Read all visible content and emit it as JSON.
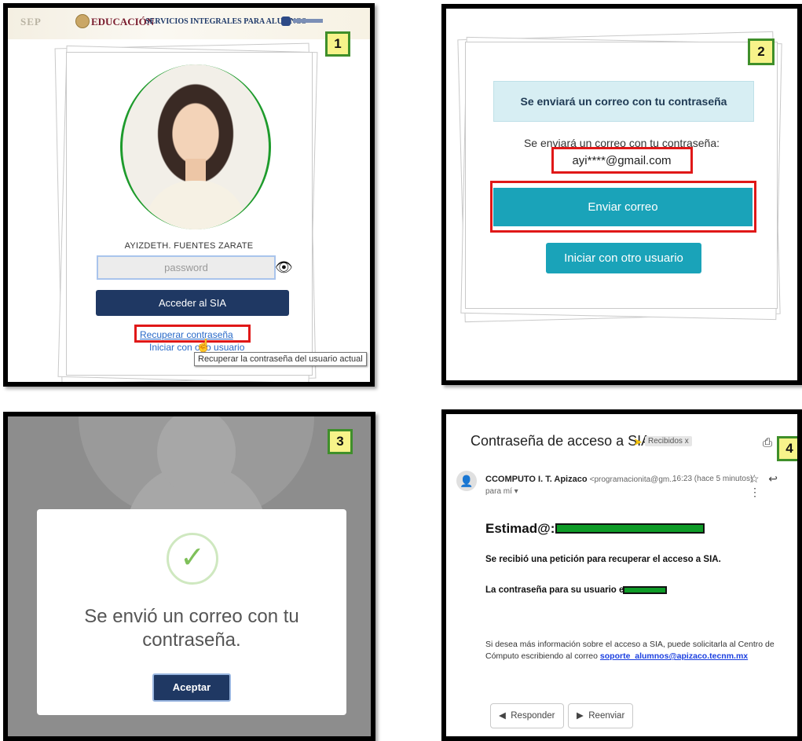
{
  "panel1": {
    "badge": "1",
    "header": {
      "logo_left": "SEP",
      "education": "EDUCACIÓN",
      "services": "SERVICIOS INTEGRALES PARA ALUMNOS"
    },
    "user_name": "AYIZDETH. FUENTES ZARATE",
    "password_placeholder": "password",
    "login_button": "Acceder al SIA",
    "recover_link": "Recuperar contraseña",
    "other_user_link": "Iniciar con otro usuario",
    "tooltip": "Recuperar la contraseña del usuario actual",
    "icons": {
      "eye": "eye-icon",
      "cursor": "hand-cursor-icon"
    }
  },
  "panel2": {
    "badge": "2",
    "info_title": "Se enviará un correo con tu contraseña",
    "info_text": "Se enviará un correo con tu contraseña:",
    "email": "ayi****@gmail.com",
    "send_button": "Enviar correo",
    "other_user_button": "Iniciar con otro usuario"
  },
  "panel3": {
    "badge": "3",
    "modal_title": "Se envió un correo con tu contraseña.",
    "accept_button": "Aceptar",
    "icons": {
      "check": "check-icon"
    }
  },
  "panel4": {
    "badge": "4",
    "subject": "Contraseña de acceso a SIA",
    "label": "Recibidos x",
    "sender_name": "CCOMPUTO I. T. Apizaco",
    "sender_address": "<programacionita@gm...",
    "time": "16:23 (hace 5 minutos)",
    "to": "para mí ▾",
    "greeting": "Estimad@:",
    "line1": "Se recibió una petición para recuperar el acceso a SIA.",
    "line2": "La contraseña para su usuario es:",
    "info_text": "Si desea más información sobre el acceso a SIA, puede solicitarla al Centro de Cómputo escribiendo al correo",
    "support_email": "soporte_alumnos@apizaco.tecnm.mx",
    "reply_button": "Responder",
    "forward_button": "Reenviar"
  },
  "colors": {
    "badge_fill": "#f7f38a",
    "badge_border": "#3f8f2a",
    "highlight": "#e01818",
    "primary_navy": "#1f3863",
    "teal": "#1aa3b9"
  }
}
